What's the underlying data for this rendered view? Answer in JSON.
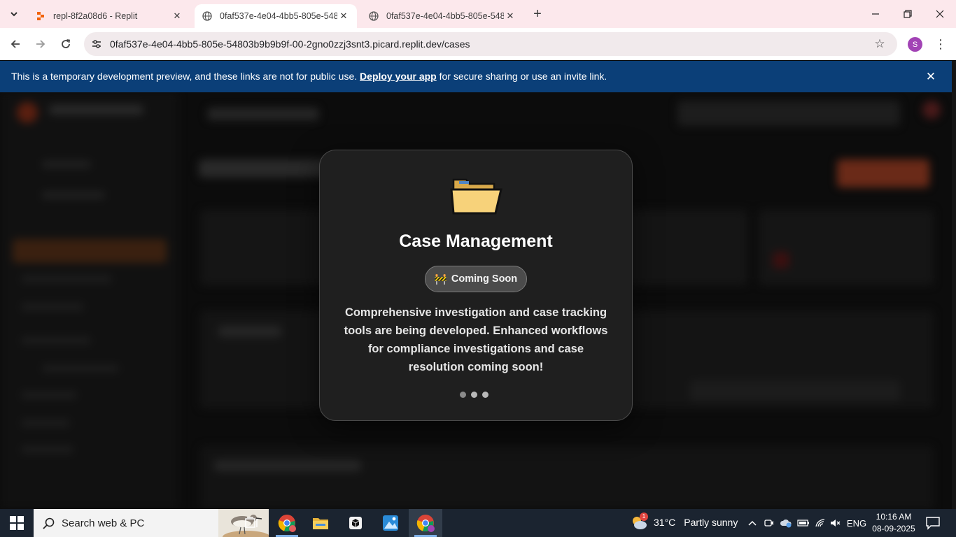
{
  "browser": {
    "tabs": [
      {
        "title": "repl-8f2a08d6 - Replit",
        "active": false
      },
      {
        "title": "0faf537e-4e04-4bb5-805e-548",
        "active": true
      },
      {
        "title": "0faf537e-4e04-4bb5-805e-548",
        "active": false
      }
    ],
    "url": "0faf537e-4e04-4bb5-805e-54803b9b9b9f-00-2gno0zzj3snt3.picard.replit.dev/cases",
    "profile_initial": "S"
  },
  "banner": {
    "text_before": "This is a temporary development preview, and these links are not for public use.",
    "link_text": "Deploy your app",
    "text_after": "for secure sharing or use an invite link."
  },
  "modal": {
    "icon": "folder-icon",
    "title": "Case Management",
    "badge_emoji": "🚧",
    "badge_label": "Coming Soon",
    "description": "Comprehensive investigation and case tracking tools are being developed. Enhanced workflows for compliance investigations and case resolution coming soon!"
  },
  "taskbar": {
    "search_placeholder": "Search web & PC",
    "weather_temp": "31°C",
    "weather_desc": "Partly sunny",
    "weather_alert_count": "1",
    "language": "ENG",
    "time": "10:16 AM",
    "date": "08-09-2025"
  },
  "colors": {
    "tabstrip": "#fce8ec",
    "banner": "#0b3f78",
    "modal_bg": "#1f1f1f",
    "taskbar": "#1b2430",
    "folder": "#f7d27a"
  }
}
